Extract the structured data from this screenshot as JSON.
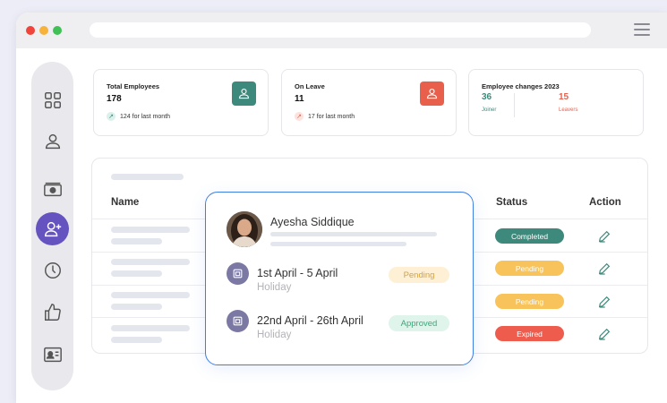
{
  "colors": {
    "accent": "#6554c0",
    "teal": "#3d8a7c",
    "coral": "#e8604c",
    "completed": "#3d8a7c",
    "pending": "#f7c35a",
    "expired": "#ee5c4e",
    "popup_border": "#3f7fe4"
  },
  "sidebar": {
    "items": [
      {
        "icon": "grid-icon"
      },
      {
        "icon": "user-icon"
      },
      {
        "icon": "money-icon"
      },
      {
        "icon": "add-user-icon",
        "active": true
      },
      {
        "icon": "clock-icon"
      },
      {
        "icon": "thumbs-up-icon"
      },
      {
        "icon": "id-card-icon"
      }
    ]
  },
  "stats": {
    "total_employees": {
      "title": "Total Employees",
      "value": "178",
      "trend": "124 for last month",
      "icon": "user-icon"
    },
    "on_leave": {
      "title": "On Leave",
      "value": "11",
      "trend": "17 for last month",
      "icon": "user-icon"
    },
    "changes": {
      "title": "Employee changes 2023",
      "joiner_value": "36",
      "joiner_label": "Joiner",
      "leaver_value": "15",
      "leaver_label": "Leavers"
    }
  },
  "table": {
    "headers": {
      "name": "Name",
      "status": "Status",
      "action": "Action"
    },
    "rows": [
      {
        "status": "Completed",
        "status_kind": "completed"
      },
      {
        "status": "Pending",
        "status_kind": "pending"
      },
      {
        "status": "Pending",
        "status_kind": "pending"
      },
      {
        "status": "Expired",
        "status_kind": "expired"
      }
    ]
  },
  "popup": {
    "name": "Ayesha Siddique",
    "leaves": [
      {
        "dates": "1st April - 5 April",
        "type": "Holiday",
        "status": "Pending"
      },
      {
        "dates": "22nd April - 26th April",
        "type": "Holiday",
        "status": "Approved"
      }
    ]
  }
}
